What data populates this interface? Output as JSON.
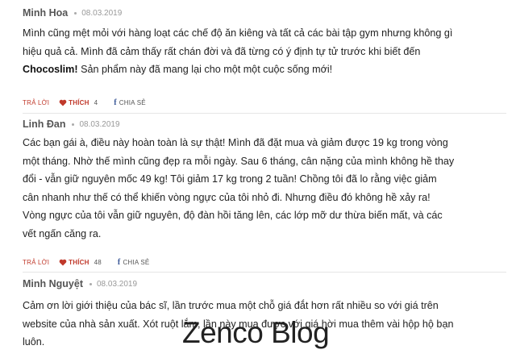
{
  "comments": [
    {
      "author": "Minh Hoa",
      "date": "08.03.2019",
      "body_lines": [
        "Mình cũng mệt mỏi với hàng loạt các chế độ ăn kiêng và tất cả các bài tập gym nhưng không gì",
        "hiệu quả cả. Mình đã cảm thấy rất chán đời và đã từng có ý định tự tử trước khi biết đến"
      ],
      "body_last_bold": "Chocoslim!",
      "body_last_rest": " Sản phẩm này đã mang lại cho một một cuộc sống mới!",
      "reply_label": "TRẢ LỜI",
      "like_label": "THÍCH",
      "like_count": "4",
      "share_label": "CHIA SẺ"
    },
    {
      "author": "Linh Đan",
      "date": "08.03.2019",
      "body_lines": [
        "Các bạn gái à, điều này hoàn toàn là sự thật! Mình đã đặt mua và giảm được 19 kg trong vòng",
        "một tháng. Nhờ thế mình cũng đẹp ra mỗi ngày. Sau 6 tháng, cân nặng của mình không hề thay",
        "đổi - vẫn giữ nguyên mốc 49 kg! Tôi giảm 17 kg trong 2 tuần! Chồng tôi đã lo rằng việc giảm",
        "cân nhanh như thế có thể khiến vòng ngực của tôi nhỏ đi. Nhưng điều đó không hề xảy ra!",
        "Vòng ngực của tôi vẫn giữ nguyên, độ đàn hồi tăng lên, các lớp mỡ dư thừa biến mất, và các",
        "vết ngấn căng ra."
      ],
      "reply_label": "TRẢ LỜI",
      "like_label": "THÍCH",
      "like_count": "48",
      "share_label": "CHIA SẺ"
    },
    {
      "author": "Minh Nguyệt",
      "date": "08.03.2019",
      "body_lines": [
        "Cảm ơn lời giới thiệu của bác sĩ, lần trước mua một chỗ giá đắt hơn rất nhiều so với giá trên",
        "website của nhà sản xuất. Xót ruột lắm, lần này mua được với giá hời mua thêm vài hộp hộ bạn",
        "luôn."
      ]
    }
  ],
  "watermark": "Zenco Blog",
  "colors": {
    "accent": "#c0392b",
    "facebook": "#3b5998",
    "divider": "#e6e6e6"
  },
  "icons": {
    "like": "heart-icon",
    "share": "facebook-icon"
  }
}
